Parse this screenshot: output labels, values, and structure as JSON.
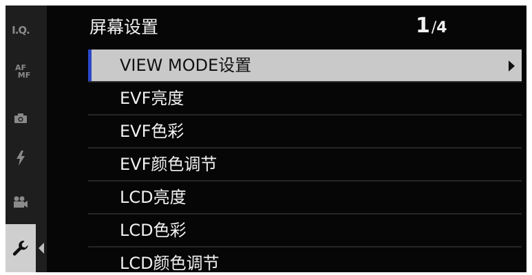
{
  "header": {
    "title": "屏幕设置",
    "page_current": "1",
    "page_separator": "/",
    "page_total": "4"
  },
  "tabs": [
    {
      "id": "image-quality",
      "label": "I.Q.",
      "icon": "iq-icon"
    },
    {
      "id": "focus",
      "label_top": "AF",
      "label_bottom": "MF",
      "icon": "af-mf-icon"
    },
    {
      "id": "shooting",
      "icon": "camera-icon"
    },
    {
      "id": "flash",
      "icon": "flash-icon"
    },
    {
      "id": "movie",
      "icon": "movie-camera-icon"
    },
    {
      "id": "setup",
      "icon": "wrench-icon",
      "active": true
    }
  ],
  "menu": {
    "items": [
      {
        "label": "VIEW MODE设置",
        "selected": true,
        "has_submenu": true
      },
      {
        "label": "EVF亮度"
      },
      {
        "label": "EVF色彩"
      },
      {
        "label": "EVF颜色调节"
      },
      {
        "label": "LCD亮度"
      },
      {
        "label": "LCD色彩"
      },
      {
        "label": "LCD颜色调节"
      }
    ]
  },
  "colors": {
    "background": "#060606",
    "tabbar": "#1e1e1e",
    "selected_row": "#c9c9c9",
    "selection_marker": "#2b47c8",
    "text": "#f2f2f2"
  }
}
